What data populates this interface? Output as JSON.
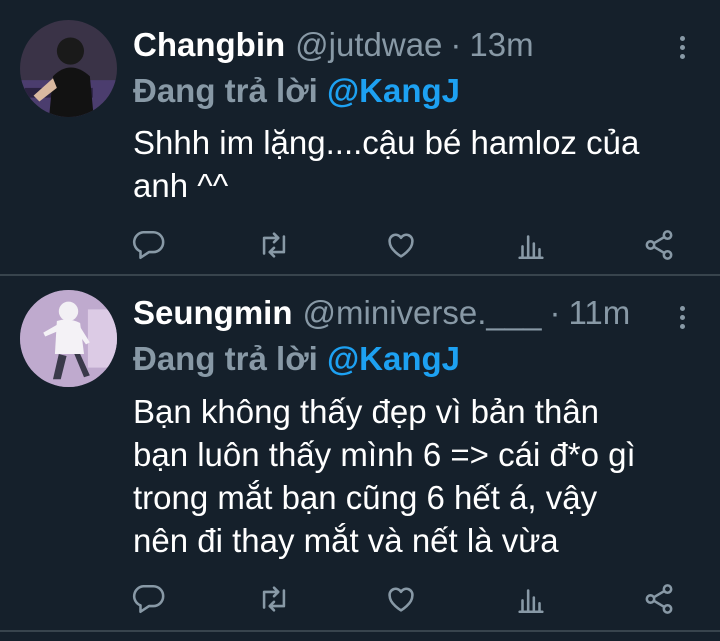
{
  "tweets": [
    {
      "name": "Changbin",
      "handle": "@jutdwae",
      "separator": "·",
      "time": "13m",
      "reply_prefix": "Đang trả lời",
      "reply_mention": "@KangJ",
      "lines": [
        "Shhh im lặng....cậu bé hamloz của",
        "anh ^^"
      ]
    },
    {
      "name": "Seungmin",
      "handle": "@miniverse.___",
      "separator": "·",
      "time": "11m",
      "reply_prefix": "Đang trả lời",
      "reply_mention": "@KangJ",
      "lines": [
        "Bạn không thấy đẹp vì bản thân",
        "bạn luôn thấy mình 6 => cái đ*o gì",
        "trong mắt bạn cũng 6 hết á, vậy",
        "nên đi thay mắt và nết là vừa"
      ]
    }
  ],
  "colors": {
    "background": "#15202b",
    "text": "#ffffff",
    "secondary": "#8899a6",
    "accent": "#1da1f2",
    "divider": "#38444d"
  },
  "icons": [
    "reply-icon",
    "retweet-icon",
    "like-icon",
    "stats-icon",
    "share-icon",
    "more-icon"
  ]
}
